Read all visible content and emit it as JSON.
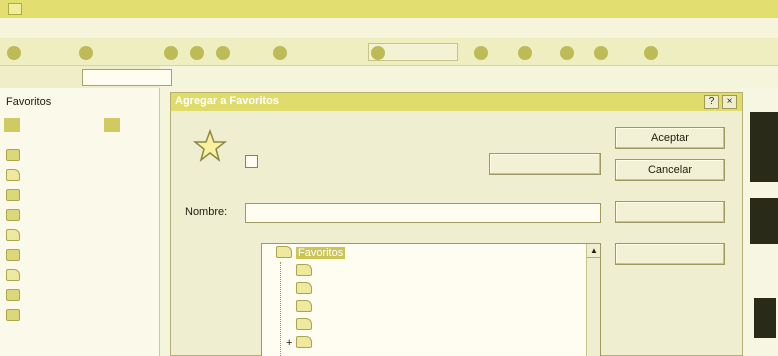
{
  "window": {
    "title": ""
  },
  "menu": {
    "items": [
      "",
      "",
      "",
      "",
      "",
      ""
    ]
  },
  "toolbar": {
    "back_label": "",
    "search_label": "",
    "favorites_label": ""
  },
  "address": {
    "label": ""
  },
  "favorites_pane": {
    "title": "Favoritos",
    "add_label": "",
    "organize_label": "",
    "items": [
      {
        "label": "",
        "kind": "page"
      },
      {
        "label": "",
        "kind": "folder"
      },
      {
        "label": "",
        "kind": "page"
      },
      {
        "label": "",
        "kind": "page"
      },
      {
        "label": "",
        "kind": "folder"
      },
      {
        "label": "",
        "kind": "page"
      },
      {
        "label": "",
        "kind": "folder"
      },
      {
        "label": "",
        "kind": "page"
      },
      {
        "label": "",
        "kind": "page"
      }
    ]
  },
  "dialog": {
    "title": "Agregar a Favoritos",
    "message": "",
    "offline_label": "",
    "offline_checked": false,
    "customize_label": "",
    "ok_label": "Aceptar",
    "cancel_label": "Cancelar",
    "name_label": "Nombre:",
    "name_value": "",
    "create_in_label": "",
    "create_in_button": "",
    "new_folder_button": "",
    "help_button": "?",
    "close_button": "×",
    "tree": [
      {
        "label": "Favoritos",
        "selected": true,
        "expander": ""
      },
      {
        "label": "",
        "selected": false,
        "expander": ""
      },
      {
        "label": "",
        "selected": false,
        "expander": ""
      },
      {
        "label": "",
        "selected": false,
        "expander": ""
      },
      {
        "label": "",
        "selected": false,
        "expander": ""
      },
      {
        "label": "",
        "selected": false,
        "expander": "+"
      }
    ]
  },
  "colors": {
    "titlebar": "#e2de70",
    "dialog_bg": "#efeed0",
    "selection": "#cbc558"
  }
}
